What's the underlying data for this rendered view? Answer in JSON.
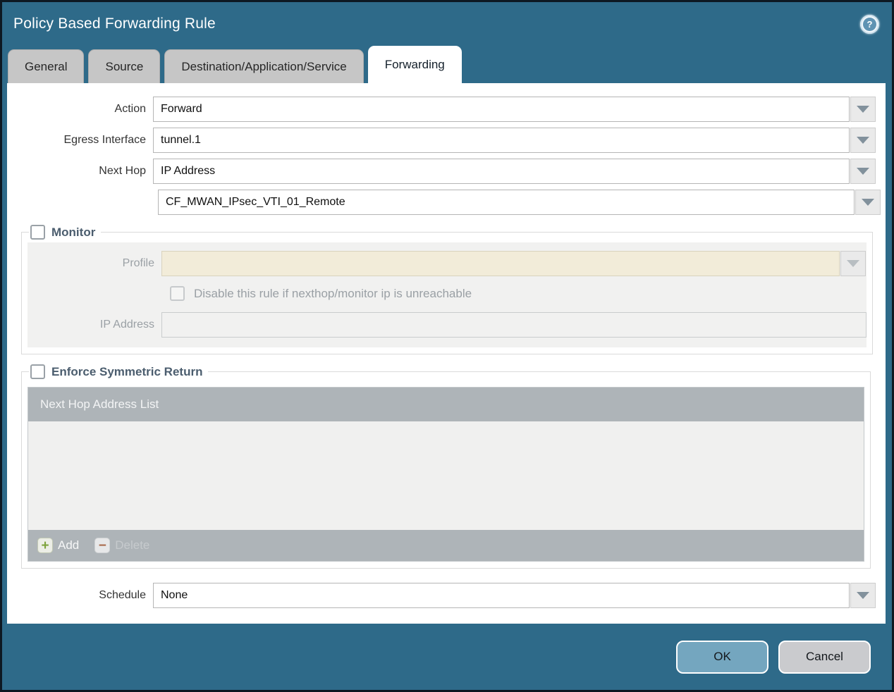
{
  "dialog": {
    "title": "Policy Based Forwarding Rule"
  },
  "icons": {
    "help": "?",
    "add": "+",
    "delete": "−"
  },
  "tabs": [
    {
      "label": "General",
      "active": false
    },
    {
      "label": "Source",
      "active": false
    },
    {
      "label": "Destination/Application/Service",
      "active": false
    },
    {
      "label": "Forwarding",
      "active": true
    }
  ],
  "form": {
    "action": {
      "label": "Action",
      "value": "Forward"
    },
    "egress_interface": {
      "label": "Egress Interface",
      "value": "tunnel.1"
    },
    "next_hop": {
      "label": "Next Hop",
      "value": "IP Address"
    },
    "next_hop_address": {
      "value": "CF_MWAN_IPsec_VTI_01_Remote"
    },
    "schedule": {
      "label": "Schedule",
      "value": "None"
    }
  },
  "monitor": {
    "legend": "Monitor",
    "checked": false,
    "profile": {
      "label": "Profile",
      "value": ""
    },
    "disable_rule": {
      "label": "Disable this rule if nexthop/monitor ip is unreachable",
      "checked": false
    },
    "ip_address": {
      "label": "IP Address",
      "value": ""
    }
  },
  "symmetric_return": {
    "legend": "Enforce Symmetric Return",
    "checked": false,
    "table": {
      "header": "Next Hop Address List",
      "rows": []
    },
    "add_label": "Add",
    "delete_label": "Delete"
  },
  "footer": {
    "ok": "OK",
    "cancel": "Cancel"
  },
  "colors": {
    "frame_teal": "#2e6a89",
    "tab_inactive": "#c6c6c6",
    "profile_field_cream": "#f2ecd9",
    "table_header_gray": "#aeb4b8",
    "ok_button": "#74a6bf",
    "cancel_button": "#cacbce",
    "add_icon_green": "#7da33c",
    "delete_icon_red": "#a8694b"
  }
}
